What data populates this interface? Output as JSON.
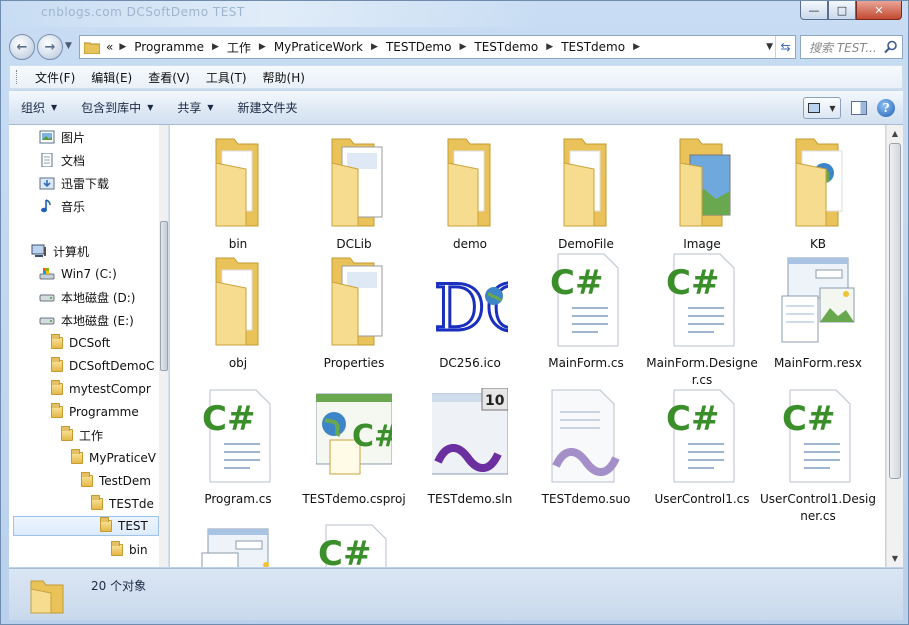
{
  "window": {
    "background_title_ghost": "cnblogs.com DCSoftDemo TEST",
    "caption_buttons": {
      "minimize": "—",
      "maximize": "□",
      "close": "✕"
    }
  },
  "nav": {
    "back_icon": "back-arrow-icon",
    "forward_icon": "forward-arrow-icon",
    "breadcrumb": [
      "Programme",
      "工作",
      "MyPraticeWork",
      "TESTDemo",
      "TESTdemo",
      "TESTdemo"
    ],
    "overflow": "«",
    "search_placeholder": "搜索 TEST..."
  },
  "menu": [
    "文件(F)",
    "编辑(E)",
    "查看(V)",
    "工具(T)",
    "帮助(H)"
  ],
  "toolbar": {
    "organize": "组织",
    "include_in_library": "包含到库中",
    "share": "共享",
    "new_folder": "新建文件夹"
  },
  "navpane": {
    "items": [
      {
        "label": "图片",
        "icon": "pictures-icon"
      },
      {
        "label": "文档",
        "icon": "documents-icon"
      },
      {
        "label": "迅雷下载",
        "icon": "download-folder-icon"
      },
      {
        "label": "音乐",
        "icon": "music-icon"
      },
      {
        "label": "计算机",
        "icon": "computer-icon"
      },
      {
        "label": "Win7 (C:)",
        "icon": "system-drive-icon"
      },
      {
        "label": "本地磁盘 (D:)",
        "icon": "drive-icon"
      },
      {
        "label": "本地磁盘 (E:)",
        "icon": "drive-icon"
      },
      {
        "label": "DCSoft",
        "icon": "folder-icon"
      },
      {
        "label": "DCSoftDemoC",
        "icon": "folder-icon"
      },
      {
        "label": "mytestCompr",
        "icon": "folder-icon"
      },
      {
        "label": "Programme",
        "icon": "folder-icon"
      },
      {
        "label": "工作",
        "icon": "folder-icon"
      },
      {
        "label": "MyPraticeV",
        "icon": "folder-icon"
      },
      {
        "label": "TestDem",
        "icon": "folder-icon"
      },
      {
        "label": "TESTde",
        "icon": "folder-icon"
      },
      {
        "label": "TEST",
        "icon": "folder-icon"
      },
      {
        "label": "bin",
        "icon": "folder-icon"
      }
    ]
  },
  "files": [
    {
      "name": "bin",
      "type": "folder-icon"
    },
    {
      "name": "DCLib",
      "type": "folder-with-docs-icon"
    },
    {
      "name": "demo",
      "type": "folder-icon"
    },
    {
      "name": "DemoFile",
      "type": "folder-icon"
    },
    {
      "name": "Image",
      "type": "folder-with-picture-icon"
    },
    {
      "name": "KB",
      "type": "folder-with-globe-icon"
    },
    {
      "name": "obj",
      "type": "folder-icon"
    },
    {
      "name": "Properties",
      "type": "folder-with-docs-icon"
    },
    {
      "name": "DC256.ico",
      "type": "dc-logo-icon"
    },
    {
      "name": "MainForm.cs",
      "type": "csharp-file-icon"
    },
    {
      "name": "MainForm.Designer.cs",
      "type": "csharp-file-icon"
    },
    {
      "name": "MainForm.resx",
      "type": "resx-file-icon"
    },
    {
      "name": "Program.cs",
      "type": "csharp-file-icon"
    },
    {
      "name": "TESTdemo.csproj",
      "type": "csproj-file-icon"
    },
    {
      "name": "TESTdemo.sln",
      "type": "vs-solution-icon"
    },
    {
      "name": "TESTdemo.suo",
      "type": "vs-suo-icon"
    },
    {
      "name": "UserControl1.cs",
      "type": "csharp-file-icon"
    },
    {
      "name": "UserControl1.Designer.cs",
      "type": "csharp-file-icon"
    },
    {
      "name": "",
      "type": "resx-file-icon"
    },
    {
      "name": "",
      "type": "csharp-file-icon"
    }
  ],
  "vs_badge": "10",
  "status": {
    "count_text": "20 个对象"
  },
  "colors": {
    "csharp_green": "#3a8f2a",
    "folder_yellow": "#f1d27a",
    "dc_blue": "#1a2fbf"
  }
}
